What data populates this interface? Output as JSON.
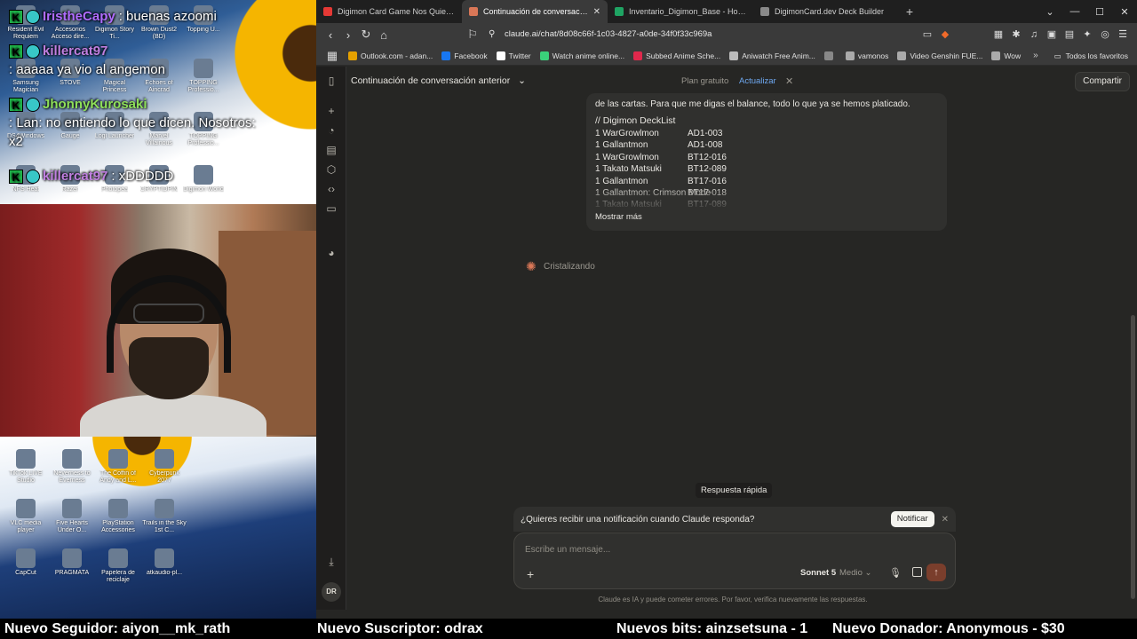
{
  "stream_overlay": {
    "chat": [
      {
        "user": "IristheCapy",
        "message": ": buenas azoomi",
        "user_color": "#b06cff"
      },
      {
        "user": "killercat97",
        "message": ": aaaaa ya vio al angemon",
        "user_color": "#c07fe0"
      },
      {
        "user": "JhonnyKurosaki",
        "message": ": Lan: no entiendo lo que dicen. Nosotros: x2",
        "user_color": "#8ee05a"
      },
      {
        "user": "killercat97",
        "message": ": xDDDDD",
        "user_color": "#c07fe0"
      }
    ],
    "desktop_icons_top": [
      "Resident Evil Requiem",
      "Accesorios Acceso dire...",
      "Digimon Story Ti...",
      "Brown Dust2 (BD)",
      "Topping U...",
      "Samsung Magician",
      "STOVE",
      "Magical Princess",
      "Echoes of Aincrad",
      "TOPPING Professio...",
      "DS4Windows",
      "Gauge",
      "Logi Launcher",
      "Marvel Villainous",
      "TOPPING Professio...",
      "NFS Heat",
      "Razer",
      "Photopea",
      "CRYPTIDPIN",
      "Digimon World"
    ],
    "desktop_icons_bottom": [
      "TikTok LIVE Studio",
      "Neverness to Everness",
      "The Coffin of Andy and L...",
      "Cyberpunk 2077",
      "VLC media player",
      "Five Hearts Under O...",
      "PlayStation Accessories",
      "Trails in the Sky 1st C...",
      "CapCut",
      "PRAGMATA",
      "Papelera de reciclaje",
      "atkaudio-pl..."
    ]
  },
  "browser": {
    "tabs": [
      {
        "label": "Digimon Card Game Nos Quiere Dej",
        "active": false,
        "icon_color": "#e53935",
        "icon": "youtube-icon"
      },
      {
        "label": "Continuación de conversación a",
        "active": true,
        "icon_color": "#d97757",
        "icon": "claude-icon"
      },
      {
        "label": "Inventario_Digimon_Base - Hojas de",
        "active": false,
        "icon_color": "#1fa463",
        "icon": "sheets-icon"
      },
      {
        "label": "DigimonCard.dev Deck Builder",
        "active": false,
        "icon_color": "#8a8a8a",
        "icon": "globe-icon"
      }
    ],
    "url": "claude.ai/chat/8d08c66f-1c03-4827-a0de-34f0f33c969a",
    "bookmarks": [
      {
        "label": "Outlook.com - adan...",
        "color": "#e5a100"
      },
      {
        "label": "Facebook",
        "color": "#1877f2"
      },
      {
        "label": "Twitter",
        "color": "#ffffff"
      },
      {
        "label": "Watch anime online...",
        "color": "#3ad07a"
      },
      {
        "label": "Subbed Anime Sche...",
        "color": "#e0284c"
      },
      {
        "label": "Aniwatch Free Anim...",
        "color": "#bbbbbb"
      },
      {
        "label": "",
        "color": "#888888"
      },
      {
        "label": "vamonos",
        "color": "#aaaaaa"
      },
      {
        "label": "Video Genshin FUE...",
        "color": "#aaaaaa"
      },
      {
        "label": "Wow",
        "color": "#aaaaaa"
      }
    ],
    "bookmarks_all": "Todos los favoritos"
  },
  "app": {
    "conversation_title": "Continuación de conversación anterior",
    "plan_label": "Plan gratuito",
    "upgrade_label": "Actualizar",
    "share_label": "Compartir",
    "message_intro": "de las cartas. Para que me digas el balance, todo lo que ya se hemos platicado.",
    "deck_title": "// Digimon DeckList",
    "deck": [
      {
        "name": "1 WarGrowlmon",
        "code": "AD1-003"
      },
      {
        "name": "1 Gallantmon",
        "code": "AD1-008"
      },
      {
        "name": "1 WarGrowlmon",
        "code": "BT12-016"
      },
      {
        "name": "1 Takato Matsuki",
        "code": "BT12-089"
      },
      {
        "name": "1 Gallantmon",
        "code": "BT17-016"
      },
      {
        "name": "1 Gallantmon: Crimson Mode",
        "code": "BT17-018"
      },
      {
        "name": "1 Takato Matsuki",
        "code": "BT17-089"
      }
    ],
    "show_more": "Mostrar más",
    "thinking_label": "Cristalizando",
    "quick_reply": "Respuesta rápida",
    "notify_text": "¿Quieres recibir una notificación cuando Claude responda?",
    "notify_button": "Notificar",
    "composer_placeholder": "Escribe un mensaje...",
    "model_name": "Sonnet 5",
    "effort_label": "Medio",
    "disclaimer": "Claude es IA y puede cometer errores. Por favor, verifica nuevamente las respuestas.",
    "avatar_initials": "DR",
    "accent_color": "#d97757"
  },
  "ticker": {
    "follower": "Nuevo Seguidor: aiyon__mk_rath",
    "subscriber": "Nuevo Suscriptor: odrax",
    "bits": "Nuevos bits: ainzsetsuna - 1",
    "donor": "Nuevo Donador: Anonymous - $30"
  }
}
